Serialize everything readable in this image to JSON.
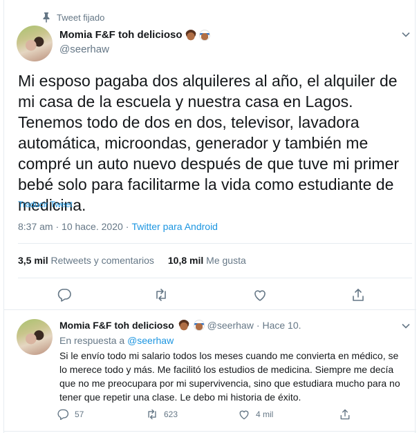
{
  "pinned": {
    "label": "Tweet fijado",
    "icon": "pin-icon"
  },
  "tweet": {
    "author_name": "Momia F&F toh delicioso",
    "author_handle": "@seerhaw",
    "text": "Mi esposo pagaba dos alquileres al año, el alquiler de mi casa de la escuela y nuestra casa en Lagos. Tenemos todo de dos en dos, televisor, lavadora automática, microondas, generador y también me compré un auto nuevo después de que tuve mi primer bebé solo para facilitarme la vida como estudiante de medicina.",
    "translate_label": "Traducir Tweet",
    "time": "8:37 am · 10 hace. 2020",
    "separator": "·",
    "source": "Twitter para Android",
    "retweets_count": "3,5 mil",
    "retweets_label": "Retweets y comentarios",
    "likes_count": "10,8 mil",
    "likes_label": "Me gusta"
  },
  "reply": {
    "author_name": "Momia F&F toh delicioso",
    "author_handle": "@seerhaw",
    "dot": "·",
    "time": "Hace 10.",
    "replying_prefix": "En respuesta a",
    "replying_to": "@seerhaw",
    "text": "Si le envío todo mi salario todos los meses cuando me convierta en médico, se lo merece todo y más. Me facilitó los estudios de medicina. Siempre me decía que no me preocupara por mi supervivencia, sino que estudiara mucho para no tener que repetir una clase. Le debo mi historia de éxito.",
    "replies_count": "57",
    "retweets_count": "623",
    "likes_count": "4 mil"
  },
  "colors": {
    "link": "#1b95e0",
    "muted": "#657786",
    "text": "#14171a",
    "border": "#e6ecf0"
  }
}
